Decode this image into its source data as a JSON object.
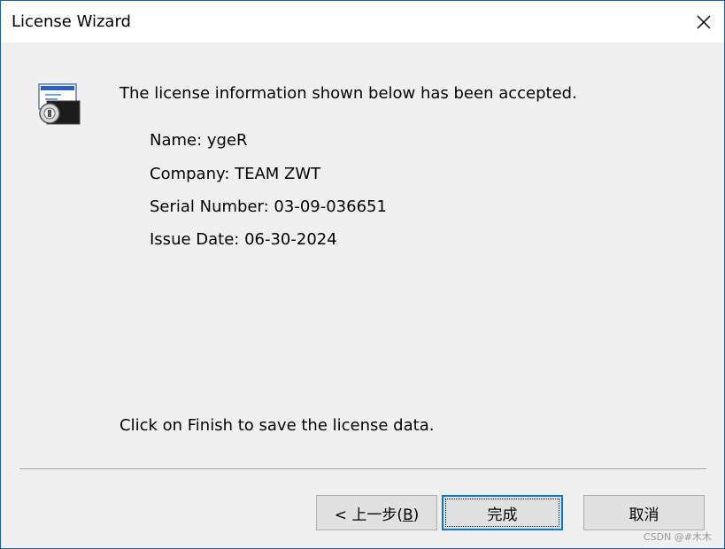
{
  "window": {
    "title": "License Wizard"
  },
  "content": {
    "headline": "The license information shown below has been accepted.",
    "info": [
      "Name: ygeR",
      "Company: TEAM ZWT",
      "Serial Number: 03-09-036651",
      "Issue Date: 06-30-2024"
    ],
    "footer": "Click on Finish to save the license data."
  },
  "buttons": {
    "back_prefix": "< 上一步(",
    "back_key": "B",
    "back_suffix": ")",
    "finish": "完成",
    "cancel": "取消"
  },
  "watermark": "CSDN @#木木",
  "colors": {
    "accent": "#0078d7",
    "title_bg": "#ffffff",
    "body_bg": "#f0f0f0"
  },
  "icons": {
    "close": "close-icon",
    "app": "license-key-icon"
  }
}
